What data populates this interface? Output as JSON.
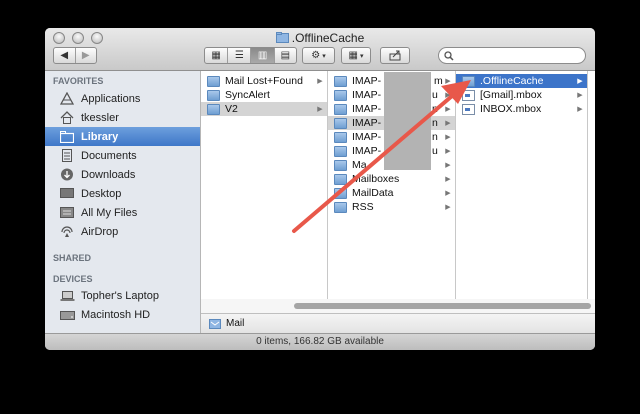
{
  "window": {
    "title": ".OfflineCache"
  },
  "toolbar": {
    "back_icon": "chevron-left-icon",
    "forward_icon": "chevron-right-icon",
    "view_modes": [
      "icon-view",
      "list-view",
      "column-view",
      "cover-flow-view"
    ],
    "selected_view": "column-view",
    "action_icon": "gear-icon",
    "arrange_icon": "grid-arrange-icon",
    "share_icon": "share-icon",
    "search_placeholder": ""
  },
  "sidebar": {
    "favorites_header": "FAVORITES",
    "favorites": [
      {
        "label": "Applications",
        "icon": "applications-icon"
      },
      {
        "label": "tkessler",
        "icon": "home-icon"
      },
      {
        "label": "Library",
        "icon": "folder-icon",
        "selected": true
      },
      {
        "label": "Documents",
        "icon": "documents-icon"
      },
      {
        "label": "Downloads",
        "icon": "downloads-icon"
      },
      {
        "label": "Desktop",
        "icon": "desktop-icon"
      },
      {
        "label": "All My Files",
        "icon": "all-files-icon"
      },
      {
        "label": "AirDrop",
        "icon": "airdrop-icon"
      }
    ],
    "shared_header": "SHARED",
    "devices_header": "DEVICES",
    "devices": [
      {
        "label": "Topher's Laptop",
        "icon": "laptop-icon"
      },
      {
        "label": "Macintosh HD",
        "icon": "hard-drive-icon"
      }
    ]
  },
  "columns": [
    {
      "items": [
        {
          "label": "Mail Lost+Found",
          "type": "folder",
          "arrow": true
        },
        {
          "label": "SyncAlert",
          "type": "folder",
          "arrow": false
        },
        {
          "label": "V2",
          "type": "folder",
          "arrow": true,
          "state": "highlighted"
        }
      ]
    },
    {
      "items": [
        {
          "label": "IMAP-",
          "suffix": "m",
          "type": "folder",
          "arrow": true
        },
        {
          "label": "IMAP-",
          "suffix": "u",
          "type": "folder",
          "arrow": true
        },
        {
          "label": "IMAP-",
          "suffix": "n",
          "type": "folder",
          "arrow": true
        },
        {
          "label": "IMAP-",
          "suffix": "n",
          "type": "folder",
          "arrow": true,
          "state": "highlighted"
        },
        {
          "label": "IMAP-",
          "suffix": "n",
          "type": "folder",
          "arrow": true
        },
        {
          "label": "IMAP-",
          "suffix": "u",
          "type": "folder",
          "arrow": true
        },
        {
          "label": "Ma",
          "suffix": "",
          "type": "folder",
          "arrow": true
        },
        {
          "label": "Mailboxes",
          "suffix": "",
          "type": "folder",
          "arrow": true
        },
        {
          "label": "MailData",
          "suffix": "",
          "type": "folder",
          "arrow": true
        },
        {
          "label": "RSS",
          "suffix": "",
          "type": "folder",
          "arrow": true
        }
      ]
    },
    {
      "items": [
        {
          "label": ".OfflineCache",
          "type": "folder",
          "arrow": true,
          "state": "selected"
        },
        {
          "label": "[Gmail].mbox",
          "type": "mbox",
          "arrow": true
        },
        {
          "label": "INBOX.mbox",
          "type": "mbox",
          "arrow": true
        }
      ]
    }
  ],
  "pathbar": {
    "label": "Mail"
  },
  "status": {
    "text": "0 items, 166.82 GB available"
  },
  "colors": {
    "selection": "#3c74c9",
    "annotation_arrow": "#e8584a",
    "sidebar_bg": "#e4e8ee"
  }
}
